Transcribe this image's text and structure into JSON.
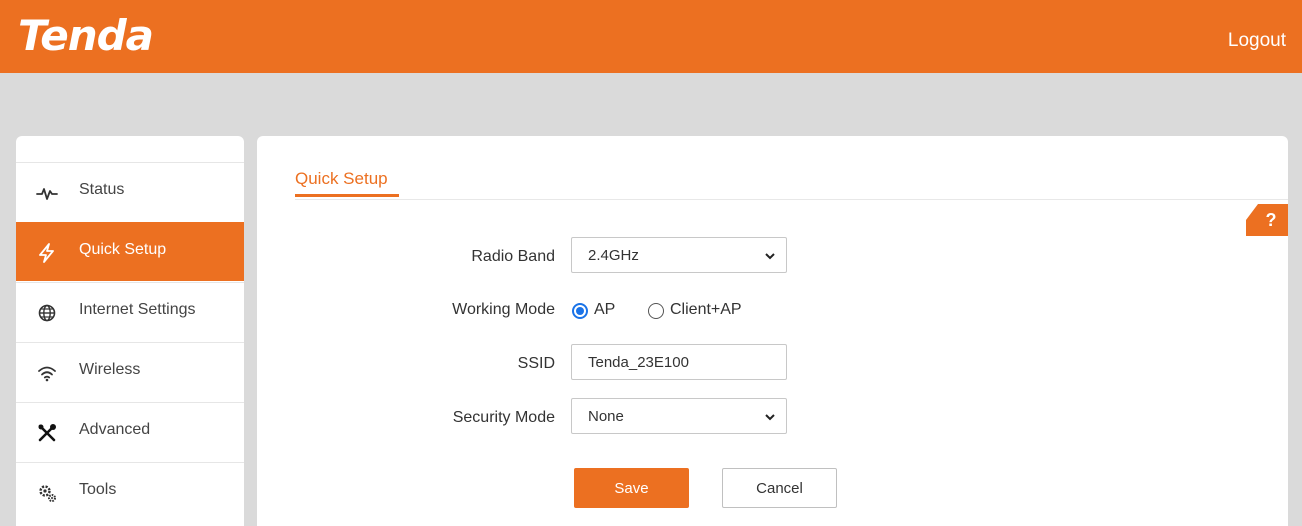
{
  "header": {
    "logo": "Tenda",
    "logout_label": "Logout"
  },
  "sidebar": {
    "items": [
      {
        "label": "Status",
        "icon": "pulse-icon",
        "active": false
      },
      {
        "label": "Quick Setup",
        "icon": "lightning-icon",
        "active": true
      },
      {
        "label": "Internet Settings",
        "icon": "globe-icon",
        "active": false
      },
      {
        "label": "Wireless",
        "icon": "wifi-icon",
        "active": false
      },
      {
        "label": "Advanced",
        "icon": "tools-icon",
        "active": false
      },
      {
        "label": "Tools",
        "icon": "gears-icon",
        "active": false
      }
    ]
  },
  "main": {
    "title": "Quick Setup",
    "help_label": "?",
    "form": {
      "radio_band": {
        "label": "Radio Band",
        "value": "2.4GHz"
      },
      "working_mode": {
        "label": "Working Mode",
        "options": [
          {
            "label": "AP",
            "selected": true
          },
          {
            "label": "Client+AP",
            "selected": false
          }
        ]
      },
      "ssid": {
        "label": "SSID",
        "value": "Tenda_23E100"
      },
      "security_mode": {
        "label": "Security Mode",
        "value": "None"
      }
    },
    "save_label": "Save",
    "cancel_label": "Cancel"
  },
  "colors": {
    "brand": "#ec7021",
    "background": "#dadada",
    "radio_selected": "#1a73e8"
  }
}
